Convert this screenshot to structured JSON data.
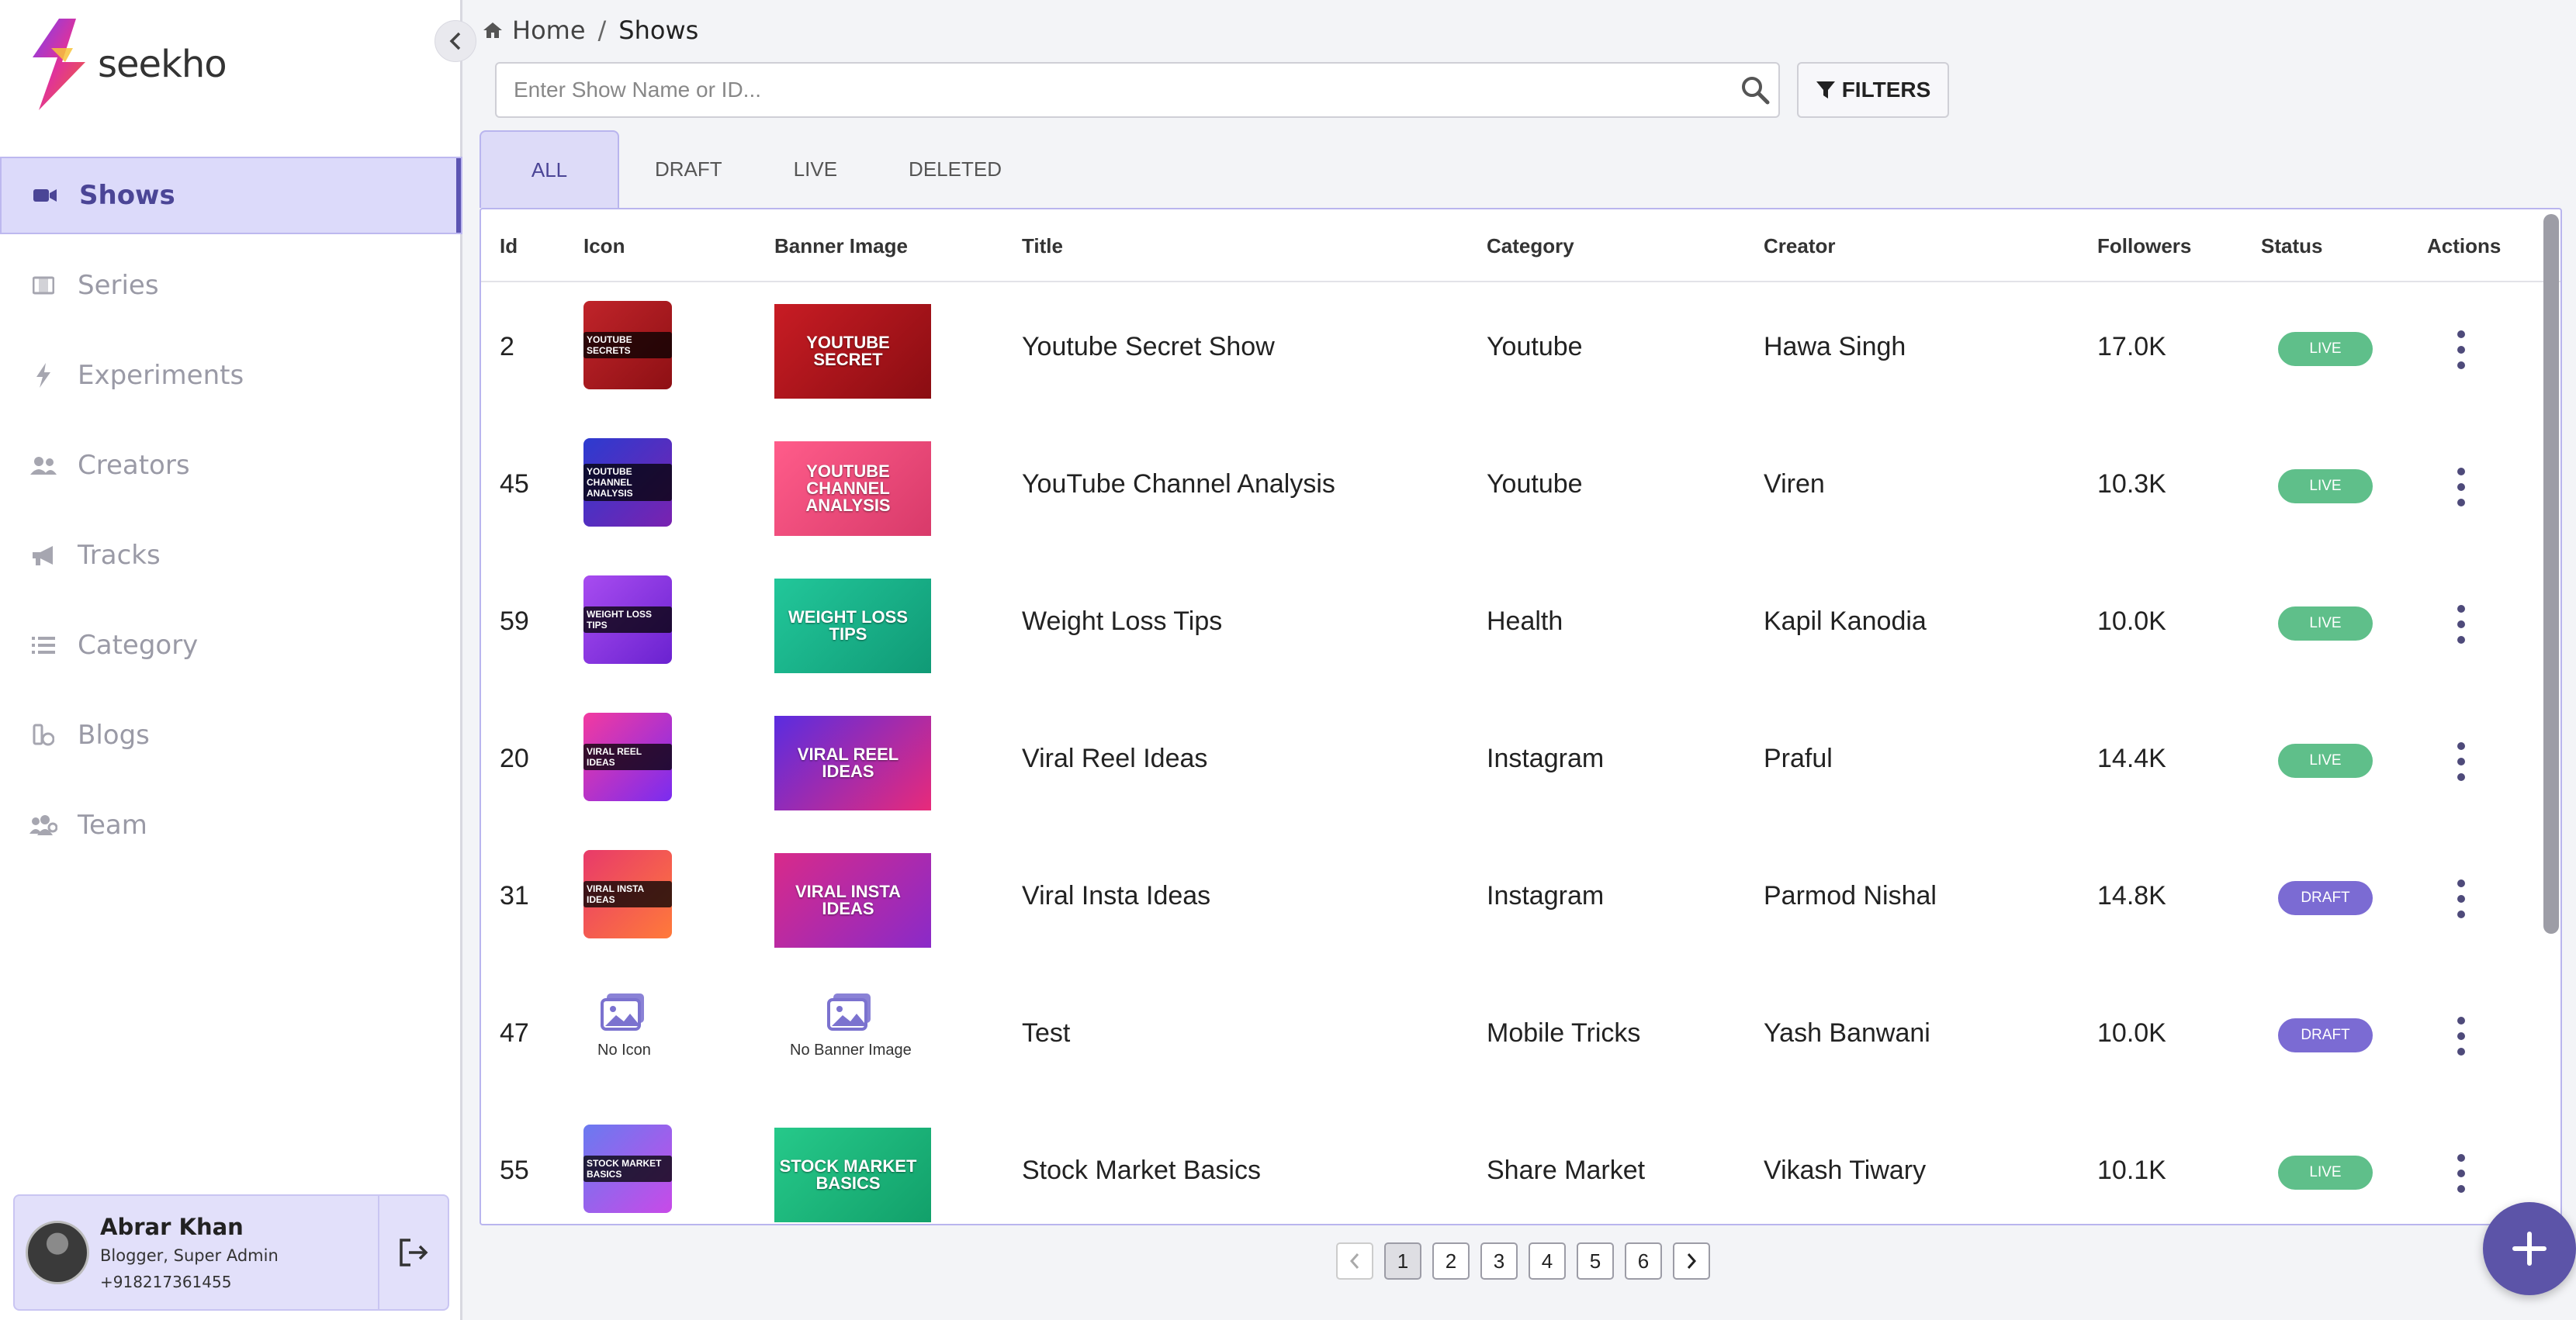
{
  "brand": {
    "name": "seekho"
  },
  "breadcrumb": {
    "home": "Home",
    "separator": "/",
    "current": "Shows"
  },
  "search": {
    "placeholder": "Enter Show Name or ID...",
    "value": ""
  },
  "filters_label": "FILTERS",
  "tabs": [
    {
      "label": "ALL",
      "active": true
    },
    {
      "label": "DRAFT",
      "active": false
    },
    {
      "label": "LIVE",
      "active": false
    },
    {
      "label": "DELETED",
      "active": false
    }
  ],
  "sidebar": {
    "items": [
      {
        "label": "Shows",
        "icon": "video-icon",
        "active": true
      },
      {
        "label": "Series",
        "icon": "film-icon",
        "active": false
      },
      {
        "label": "Experiments",
        "icon": "bolt-icon",
        "active": false
      },
      {
        "label": "Creators",
        "icon": "users-icon",
        "active": false
      },
      {
        "label": "Tracks",
        "icon": "megaphone-icon",
        "active": false
      },
      {
        "label": "Category",
        "icon": "list-icon",
        "active": false
      },
      {
        "label": "Blogs",
        "icon": "blog-icon",
        "active": false
      },
      {
        "label": "Team",
        "icon": "team-icon",
        "active": false
      }
    ]
  },
  "profile": {
    "name": "Abrar Khan",
    "role": "Blogger, Super Admin",
    "phone": "+918217361455"
  },
  "table": {
    "headers": [
      "Id",
      "Icon",
      "Banner Image",
      "Title",
      "Category",
      "Creator",
      "Followers",
      "Status",
      "Actions"
    ],
    "rows": [
      {
        "id": "2",
        "icon_text": "YOUTUBE SECRETS",
        "banner_text": "YOUTUBE SECRET",
        "title": "Youtube Secret Show",
        "category": "Youtube",
        "creator": "Hawa Singh",
        "followers": "17.0K",
        "status": "LIVE",
        "icon_colors": [
          "#c0242a",
          "#8e1014"
        ],
        "banner_colors": [
          "#c81c24",
          "#8a0d12"
        ]
      },
      {
        "id": "45",
        "icon_text": "YOUTUBE CHANNEL ANALYSIS",
        "banner_text": "YOUTUBE CHANNEL ANALYSIS",
        "title": "YouTube Channel Analysis",
        "category": "Youtube",
        "creator": "Viren",
        "followers": "10.3K",
        "status": "LIVE",
        "icon_colors": [
          "#2c3bd0",
          "#7a22b0"
        ],
        "banner_colors": [
          "#ff5c8a",
          "#d83a6a"
        ]
      },
      {
        "id": "59",
        "icon_text": "WEIGHT LOSS TIPS",
        "banner_text": "WEIGHT LOSS TIPS",
        "title": "Weight Loss Tips",
        "category": "Health",
        "creator": "Kapil Kanodia",
        "followers": "10.0K",
        "status": "LIVE",
        "icon_colors": [
          "#a84cf0",
          "#6a22d0"
        ],
        "banner_colors": [
          "#22c79a",
          "#109a76"
        ]
      },
      {
        "id": "20",
        "icon_text": "VIRAL REEL IDEAS",
        "banner_text": "VIRAL REEL IDEAS",
        "title": "Viral Reel Ideas",
        "category": "Instagram",
        "creator": "Praful",
        "followers": "14.4K",
        "status": "LIVE",
        "icon_colors": [
          "#f33aa0",
          "#7a2cf0"
        ],
        "banner_colors": [
          "#5a2ce0",
          "#e82a7a"
        ]
      },
      {
        "id": "31",
        "icon_text": "VIRAL INSTA IDEAS",
        "banner_text": "VIRAL INSTA IDEAS",
        "title": "Viral Insta Ideas",
        "category": "Instagram",
        "creator": "Parmod Nishal",
        "followers": "14.8K",
        "status": "DRAFT",
        "icon_colors": [
          "#e83a6a",
          "#ff7a3a"
        ],
        "banner_colors": [
          "#d82a8a",
          "#8a2ac8"
        ]
      },
      {
        "id": "47",
        "icon_text": "",
        "banner_text": "",
        "no_icon_label": "No Icon",
        "no_banner_label": "No Banner Image",
        "title": "Test",
        "category": "Mobile Tricks",
        "creator": "Yash Banwani",
        "followers": "10.0K",
        "status": "DRAFT"
      },
      {
        "id": "55",
        "icon_text": "STOCK MARKET BASICS",
        "banner_text": "STOCK MARKET BASICS",
        "title": "Stock Market Basics",
        "category": "Share Market",
        "creator": "Vikash Tiwary",
        "followers": "10.1K",
        "status": "LIVE",
        "icon_colors": [
          "#6a7af0",
          "#c84ae8"
        ],
        "banner_colors": [
          "#26c98a",
          "#12a06a"
        ]
      }
    ]
  },
  "pagination": {
    "pages": [
      "1",
      "2",
      "3",
      "4",
      "5",
      "6"
    ],
    "current": "1"
  },
  "colors": {
    "accent": "#5c54b2",
    "live": "#5fbf8a",
    "draft": "#7b6bd3",
    "active_bg": "#dcdafa"
  }
}
